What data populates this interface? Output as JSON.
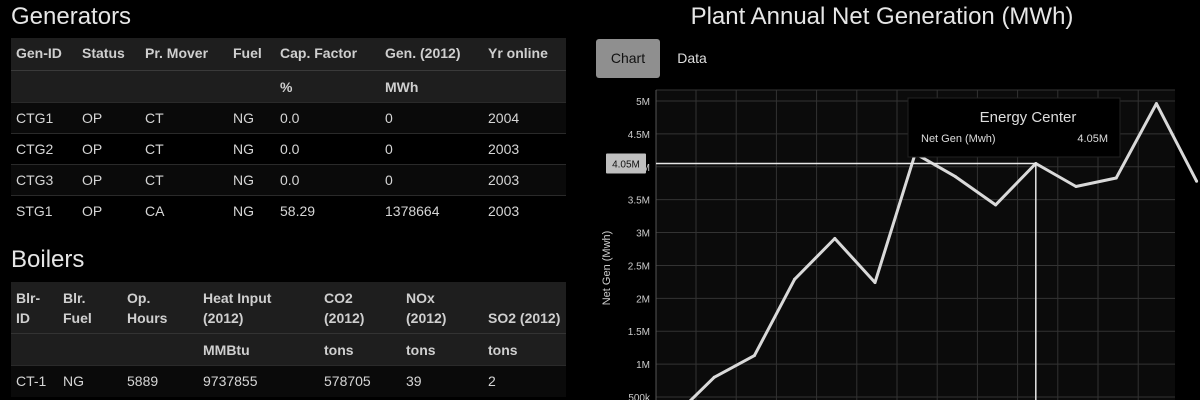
{
  "generators": {
    "title": "Generators",
    "headers": [
      "Gen-ID",
      "Status",
      "Pr. Mover",
      "Fuel",
      "Cap. Factor",
      "Gen. (2012)",
      "Yr online"
    ],
    "units": [
      "",
      "",
      "",
      "",
      "%",
      "MWh",
      ""
    ],
    "rows": [
      [
        "CTG1",
        "OP",
        "CT",
        "NG",
        "0.0",
        "0",
        "2004"
      ],
      [
        "CTG2",
        "OP",
        "CT",
        "NG",
        "0.0",
        "0",
        "2003"
      ],
      [
        "CTG3",
        "OP",
        "CT",
        "NG",
        "0.0",
        "0",
        "2003"
      ],
      [
        "STG1",
        "OP",
        "CA",
        "NG",
        "58.29",
        "1378664",
        "2003"
      ]
    ]
  },
  "boilers": {
    "title": "Boilers",
    "headers": [
      [
        "Blr-",
        "ID"
      ],
      [
        "Blr.",
        "Fuel"
      ],
      [
        "Op.",
        "Hours"
      ],
      [
        "Heat Input",
        "(2012)"
      ],
      [
        "CO2",
        "(2012)"
      ],
      [
        "NOx",
        "(2012)"
      ],
      [
        "SO2 (2012)"
      ]
    ],
    "units": [
      "",
      "",
      "",
      "MMBtu",
      "tons",
      "tons",
      "tons"
    ],
    "rows": [
      [
        "CT-1",
        "NG",
        "5889",
        "9737855",
        "578705",
        "39",
        "2"
      ]
    ]
  },
  "chart_panel": {
    "title": "Plant Annual Net Generation (MWh)",
    "tabs": {
      "chart": "Chart",
      "data": "Data"
    }
  },
  "chart_data": {
    "type": "line",
    "title": "Plant Annual Net Generation (MWh)",
    "ylabel": "Net Gen (Mwh)",
    "ylim": [
      0,
      5000000
    ],
    "y_ticks": [
      "500k",
      "1M",
      "1.5M",
      "2M",
      "2.5M",
      "3M",
      "3.5M",
      "4M",
      "4.5M",
      "5M"
    ],
    "grid": true,
    "series": [
      {
        "values": [
          200000,
          800000,
          1130000,
          2290000,
          2910000,
          2240000,
          4200000,
          3850000,
          3420000,
          4050000,
          3700000,
          3830000,
          4960000,
          3780000
        ]
      }
    ],
    "crosshair_label": "4.05M",
    "tooltip": {
      "title": "Energy Center",
      "label": "Net Gen (Mwh)",
      "value": "4.05M"
    },
    "color": "#d9d9d9"
  }
}
